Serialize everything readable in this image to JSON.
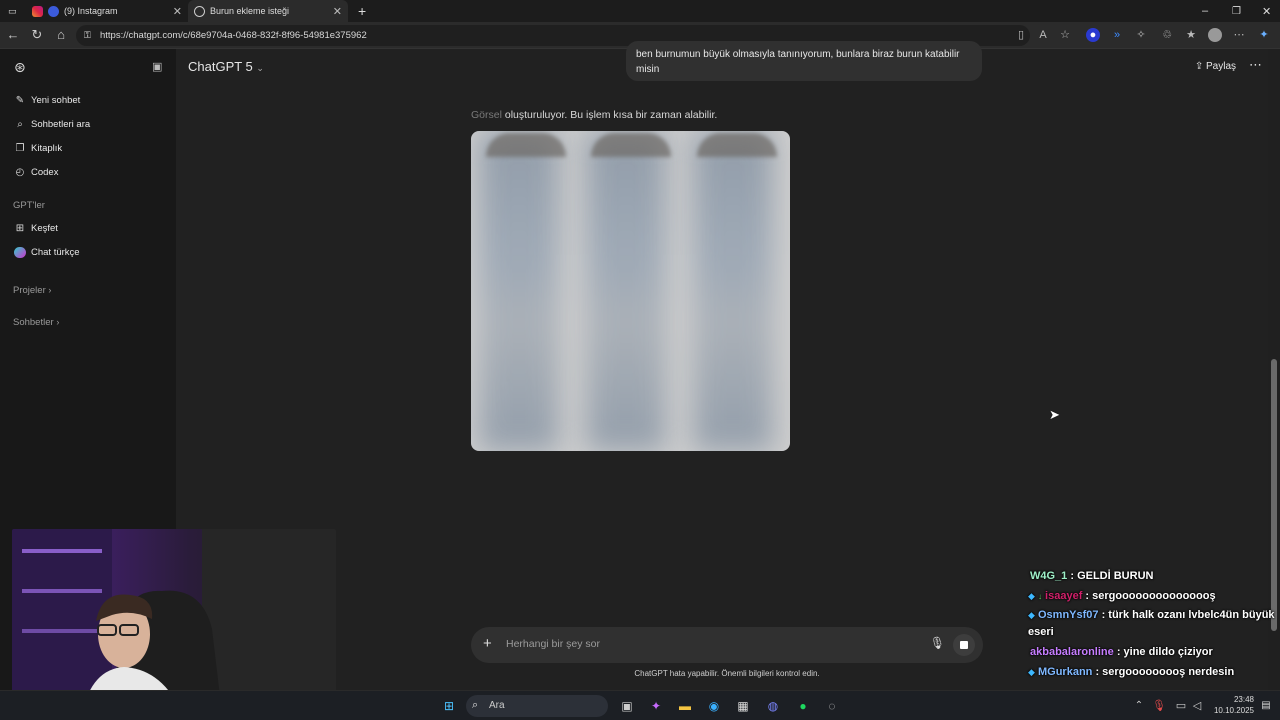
{
  "browser": {
    "tabs": [
      {
        "label": "(9) Instagram"
      },
      {
        "label": "Burun ekleme isteği"
      }
    ],
    "url": "https://chatgpt.com/c/68e9704a-0468-832f-8f96-54981e375962"
  },
  "sidebar": {
    "items": [
      {
        "label": "Yeni sohbet",
        "icon": "edit-icon"
      },
      {
        "label": "Sohbetleri ara",
        "icon": "search-icon"
      },
      {
        "label": "Kitaplık",
        "icon": "library-icon"
      },
      {
        "label": "Codex",
        "icon": "codex-icon"
      }
    ],
    "gpts_heading": "GPT'ler",
    "gpts": [
      {
        "label": "Keşfet",
        "icon": "grid-icon"
      },
      {
        "label": "Chat türkçe",
        "icon": "gpt-avatar-icon"
      }
    ],
    "projects": "Projeler",
    "chats": "Sohbetler"
  },
  "main": {
    "model": "ChatGPT 5",
    "share": "Paylaş",
    "user_message": "ben burnumun büyük olmasıyla tanınıyorum, bunlara biraz burun katabilir misin",
    "status_prefix": "Görsel",
    "status_rest": "oluşturuluyor. Bu işlem kısa bir zaman alabilir.",
    "composer_placeholder": "Herhangi bir şey sor",
    "disclaimer": "ChatGPT hata yapabilir. Önemli bilgileri kontrol edin."
  },
  "stream_chat": [
    {
      "user": "W4G_1",
      "text": " : GELDİ BURUN",
      "color": "#9ef0c8"
    },
    {
      "user": "isaayef",
      "text": " : sergooooooooooooooş",
      "color": "#d0206a"
    },
    {
      "user": "OsmnYsf07",
      "text": " : türk halk ozanı lvbelc4ün büyük",
      "cont": "eseri",
      "color": "#7fb8ff"
    },
    {
      "user": "akbabalaronline",
      "text": " : yine dildo çiziyor",
      "color": "#c67dff"
    },
    {
      "user": "MGurkann",
      "text": " : sergooooooooş nerdesin",
      "color": "#7fb8ff"
    }
  ],
  "taskbar": {
    "search": "Ara",
    "time": "23:48",
    "date": "10.10.2025"
  }
}
